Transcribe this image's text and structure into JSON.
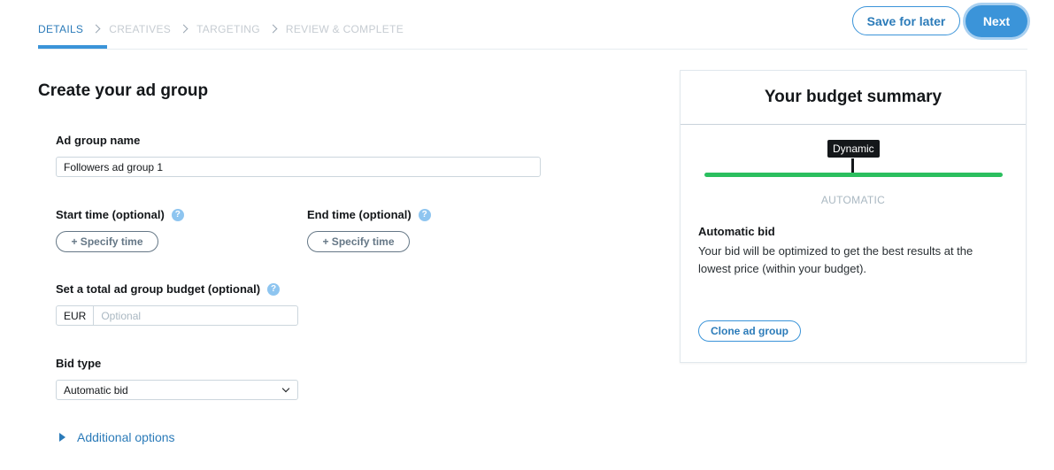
{
  "steps": {
    "details": "DETAILS",
    "creatives": "CREATIVES",
    "targeting": "TARGETING",
    "review": "REVIEW & COMPLETE"
  },
  "header": {
    "save_label": "Save for later",
    "next_label": "Next"
  },
  "form": {
    "title": "Create your ad group",
    "name_label": "Ad group name",
    "name_value": "Followers ad group 1",
    "start_label": "Start time (optional)",
    "end_label": "End time (optional)",
    "specify_time_label": "+ Specify time",
    "budget_label": "Set a total ad group budget (optional)",
    "currency": "EUR",
    "budget_placeholder": "Optional",
    "bid_type_label": "Bid type",
    "bid_type_value": "Automatic bid",
    "additional_options": "Additional options",
    "help_glyph": "?"
  },
  "summary": {
    "title": "Your budget summary",
    "tooltip": "Dynamic",
    "slider_label": "AUTOMATIC",
    "bid_title": "Automatic bid",
    "bid_description": "Your bid will be optimized to get the best results at the lowest price (within your budget).",
    "clone_label": "Clone ad group"
  },
  "colors": {
    "accent": "#3b94d9",
    "slider": "#2bbf5f"
  }
}
